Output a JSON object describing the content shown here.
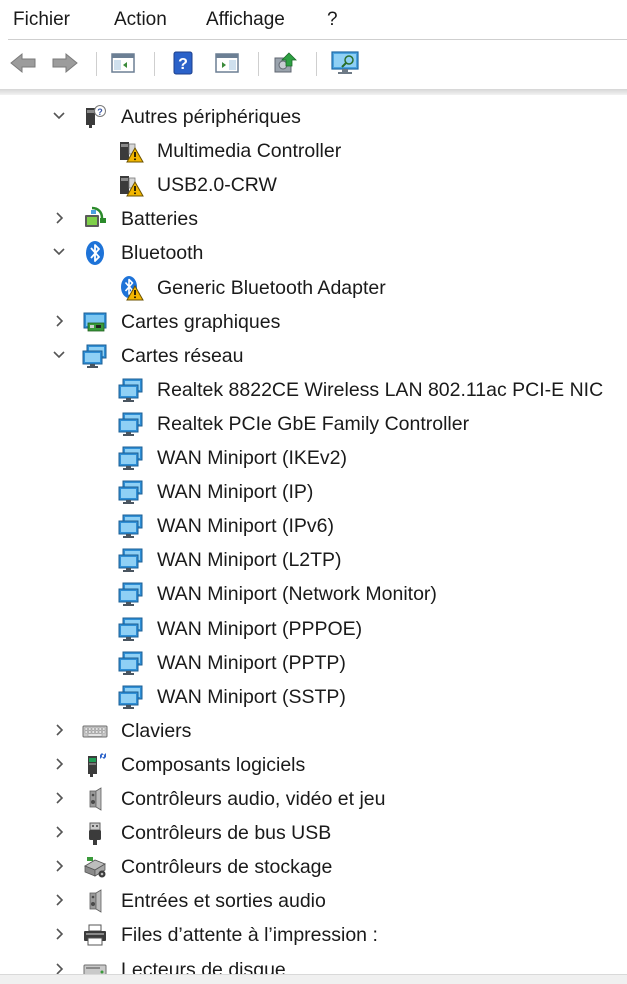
{
  "menubar": {
    "items": [
      "Fichier",
      "Action",
      "Affichage",
      "?"
    ]
  },
  "toolbar": {
    "buttons": [
      {
        "name": "back-button",
        "icon": "arrow-left-icon"
      },
      {
        "name": "forward-button",
        "icon": "arrow-right-icon"
      },
      {
        "name": "show-hide-console-tree-button",
        "icon": "console-tree-icon"
      },
      {
        "name": "help-button",
        "icon": "help-icon"
      },
      {
        "name": "show-hide-action-pane-button",
        "icon": "action-pane-icon"
      },
      {
        "name": "update-driver-button",
        "icon": "update-driver-icon"
      },
      {
        "name": "scan-hardware-button",
        "icon": "monitor-scan-icon"
      }
    ]
  },
  "tree": {
    "rows": [
      {
        "label": "Autres périphériques",
        "level": 0,
        "expanded": true,
        "icon": "unknown-device-icon"
      },
      {
        "label": "Multimedia Controller",
        "level": 1,
        "icon": "warning-device-icon"
      },
      {
        "label": "USB2.0-CRW",
        "level": 1,
        "icon": "warning-device-icon"
      },
      {
        "label": "Batteries",
        "level": 0,
        "expanded": false,
        "icon": "battery-icon"
      },
      {
        "label": "Bluetooth",
        "level": 0,
        "expanded": true,
        "icon": "bluetooth-icon"
      },
      {
        "label": "Generic Bluetooth Adapter",
        "level": 1,
        "icon": "bluetooth-warning-icon"
      },
      {
        "label": "Cartes graphiques",
        "level": 0,
        "expanded": false,
        "icon": "display-adapter-icon"
      },
      {
        "label": "Cartes réseau",
        "level": 0,
        "expanded": true,
        "icon": "network-adapter-icon"
      },
      {
        "label": "Realtek 8822CE Wireless LAN 802.11ac PCI-E NIC",
        "level": 1,
        "icon": "network-adapter-icon"
      },
      {
        "label": "Realtek PCIe GbE Family Controller",
        "level": 1,
        "icon": "network-adapter-icon"
      },
      {
        "label": "WAN Miniport (IKEv2)",
        "level": 1,
        "icon": "network-adapter-icon"
      },
      {
        "label": "WAN Miniport (IP)",
        "level": 1,
        "icon": "network-adapter-icon"
      },
      {
        "label": "WAN Miniport (IPv6)",
        "level": 1,
        "icon": "network-adapter-icon"
      },
      {
        "label": "WAN Miniport (L2TP)",
        "level": 1,
        "icon": "network-adapter-icon"
      },
      {
        "label": "WAN Miniport (Network Monitor)",
        "level": 1,
        "icon": "network-adapter-icon"
      },
      {
        "label": "WAN Miniport (PPPOE)",
        "level": 1,
        "icon": "network-adapter-icon"
      },
      {
        "label": "WAN Miniport (PPTP)",
        "level": 1,
        "icon": "network-adapter-icon"
      },
      {
        "label": "WAN Miniport (SSTP)",
        "level": 1,
        "icon": "network-adapter-icon"
      },
      {
        "label": "Claviers",
        "level": 0,
        "expanded": false,
        "icon": "keyboard-icon"
      },
      {
        "label": "Composants logiciels",
        "level": 0,
        "expanded": false,
        "icon": "software-component-icon"
      },
      {
        "label": "Contrôleurs audio, vidéo et jeu",
        "level": 0,
        "expanded": false,
        "icon": "speaker-icon"
      },
      {
        "label": "Contrôleurs de bus USB",
        "level": 0,
        "expanded": false,
        "icon": "usb-icon"
      },
      {
        "label": "Contrôleurs de stockage",
        "level": 0,
        "expanded": false,
        "icon": "storage-controller-icon"
      },
      {
        "label": "Entrées et sorties audio",
        "level": 0,
        "expanded": false,
        "icon": "speaker-icon"
      },
      {
        "label": "Files d’attente à l’impression :",
        "level": 0,
        "expanded": false,
        "icon": "printer-icon"
      },
      {
        "label": "Lecteurs de disque",
        "level": 0,
        "expanded": false,
        "icon": "disk-drive-icon"
      }
    ]
  },
  "colors": {
    "text": "#1a1a1a",
    "separator": "#cfcfcf",
    "chevron": "#555555",
    "warning": "#f2b600",
    "bluetooth": "#1e73d8",
    "network": "#2f8fd6"
  }
}
